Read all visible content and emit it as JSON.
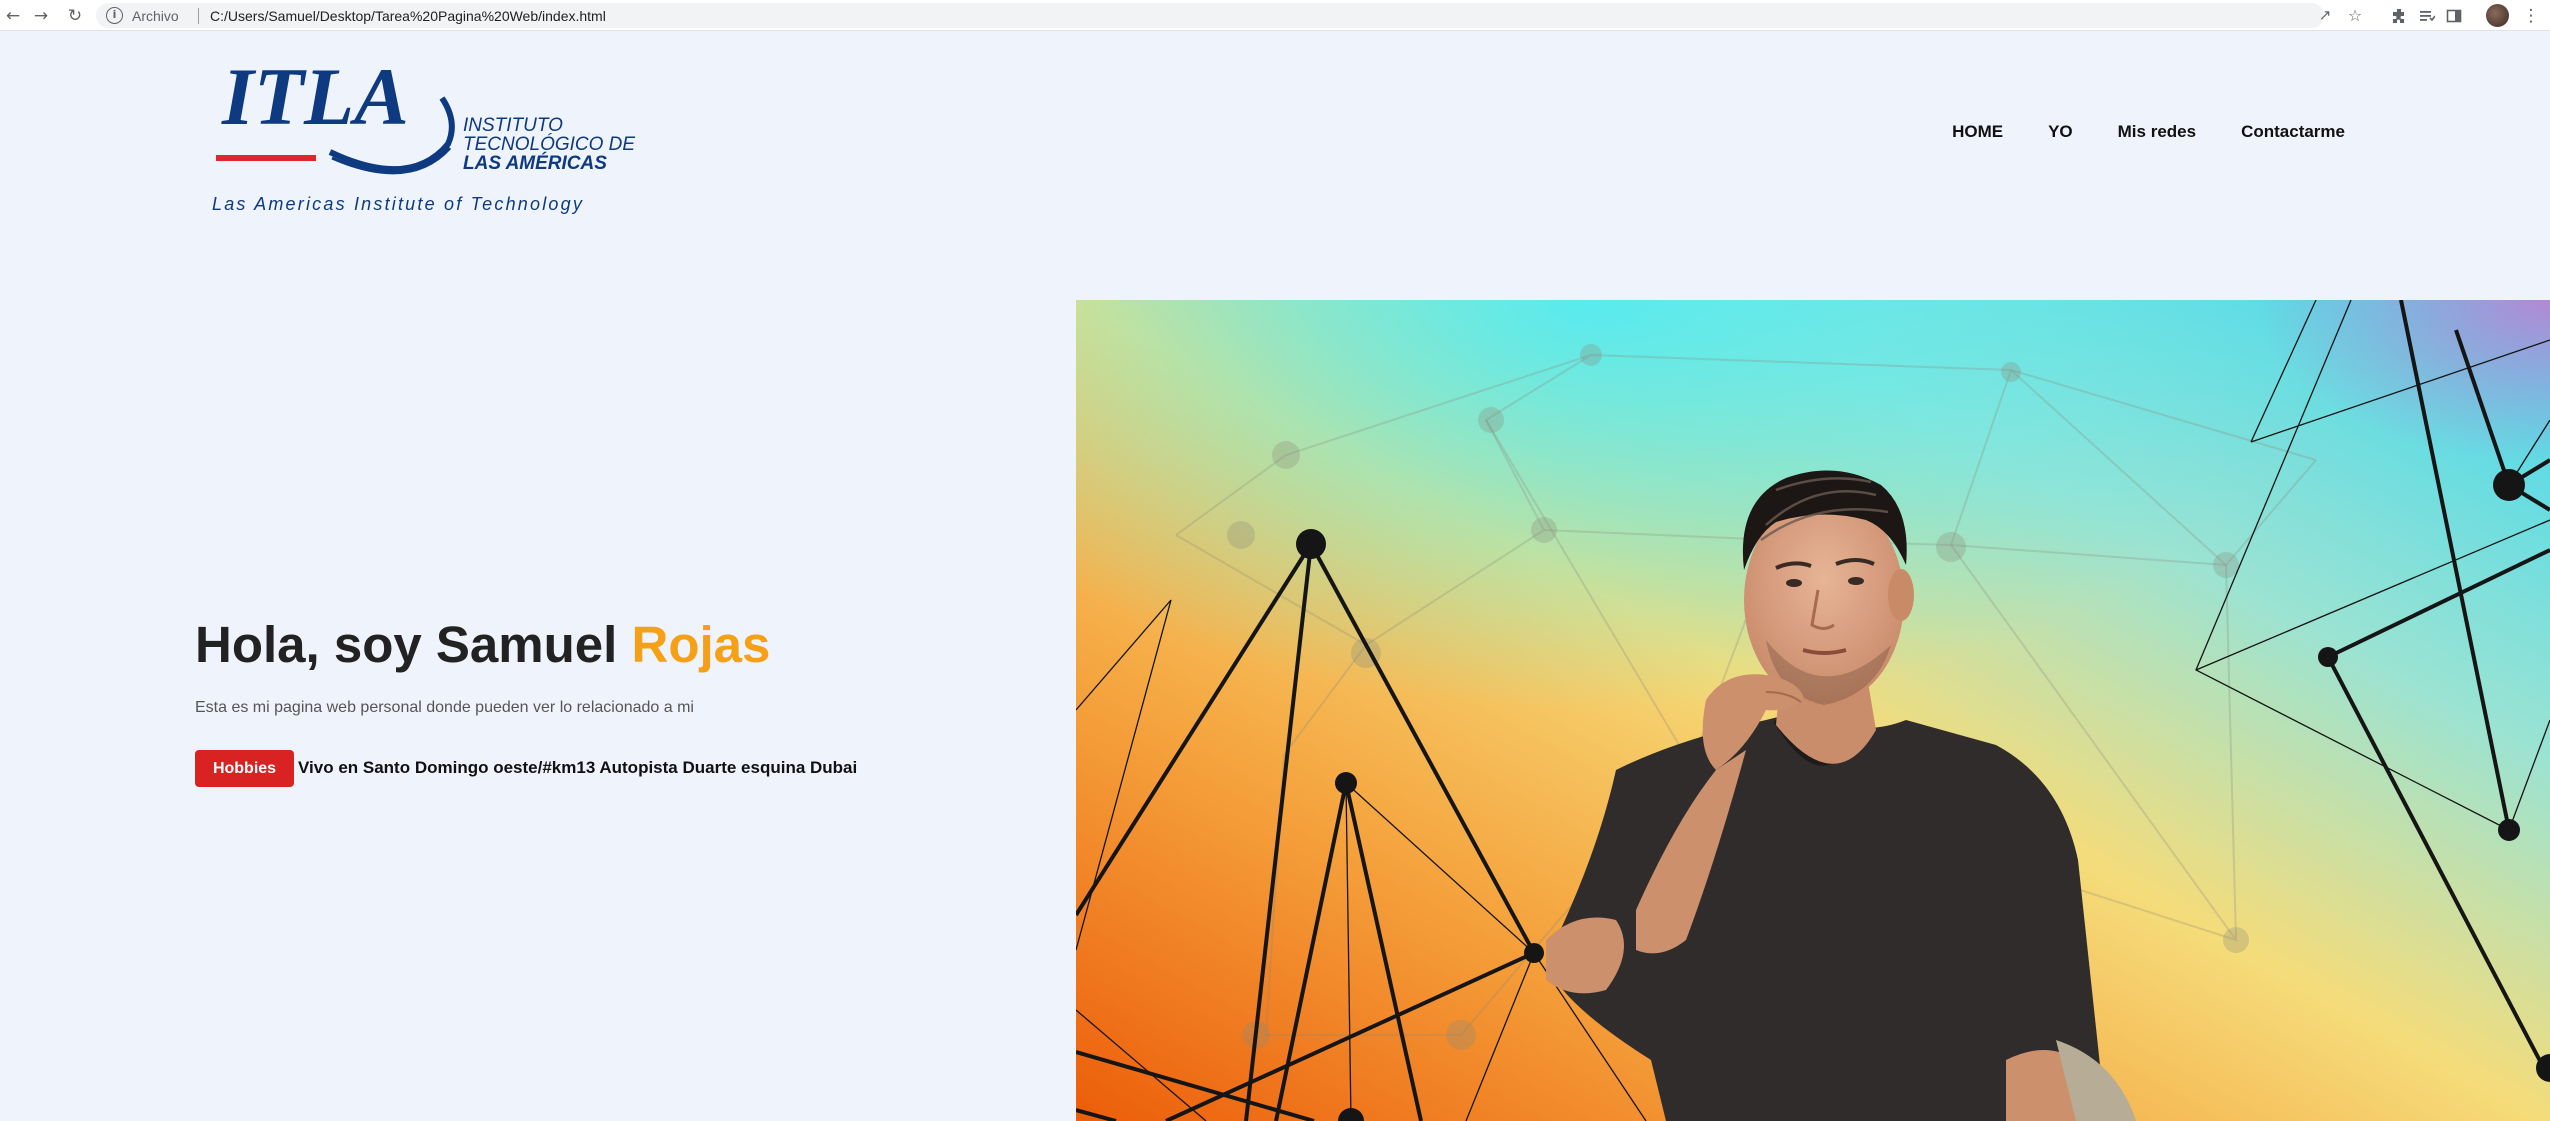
{
  "browser": {
    "back_icon": "arrow-left-icon",
    "forward_icon": "arrow-right-icon",
    "reload_icon": "reload-icon",
    "info_icon": "info-icon",
    "scheme_label": "Archivo",
    "url": "C:/Users/Samuel/Desktop/Tarea%20Pagina%20Web/index.html",
    "toolbar_icons": [
      "share-icon",
      "star-icon",
      "extensions-icon",
      "reading-list-icon",
      "side-panel-icon",
      "profile-avatar",
      "kebab-menu-icon"
    ]
  },
  "header": {
    "logo": {
      "wordmark": "ITLA",
      "line1": "INSTITUTO",
      "line2": "TECNOLÓGICO DE",
      "line3": "LAS AMÉRICAS",
      "tagline": "Las Americas Institute of Technology",
      "colors": {
        "navy": "#0d3a80",
        "red": "#e0262b"
      }
    },
    "nav": {
      "home": "HOME",
      "yo": "YO",
      "mis_redes": "Mis redes",
      "contactarme": "Contactarme"
    }
  },
  "hero": {
    "title_prefix": "Hola, soy Samuel ",
    "title_accent": "Rojas",
    "subtitle": "Esta es mi pagina web personal donde pueden ver lo relacionado a mi",
    "button_label": "Hobbies",
    "address": "Vivo en Santo Domingo oeste/#km13 Autopista Duarte esquina Dubai",
    "colors": {
      "accent": "#f5a017",
      "button": "#d92323",
      "background": "#eff3fb"
    }
  },
  "hero_image": {
    "description_icon": "profile-photo",
    "colors": {
      "cyan": "#4fe8f0",
      "yellow": "#f7d466",
      "orange": "#ee6a10",
      "shirt": "#2d2a29"
    }
  }
}
